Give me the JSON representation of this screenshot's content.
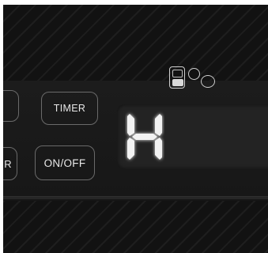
{
  "buttons": {
    "timer_label": "TIMER",
    "onoff_label": "ON/OFF",
    "partial_top_label": "",
    "partial_bottom_label": "R"
  },
  "display": {
    "text": "H",
    "digit_color": "#f2f2f2"
  },
  "indicators": {
    "icons": [
      "appliance-mode-icon",
      "small-circle-icon",
      "large-circle-icon"
    ]
  },
  "colors": {
    "background": "#151515",
    "panel": "#1c1c1c",
    "display_bg": "#232323",
    "button_border": "#6a6a6a"
  }
}
